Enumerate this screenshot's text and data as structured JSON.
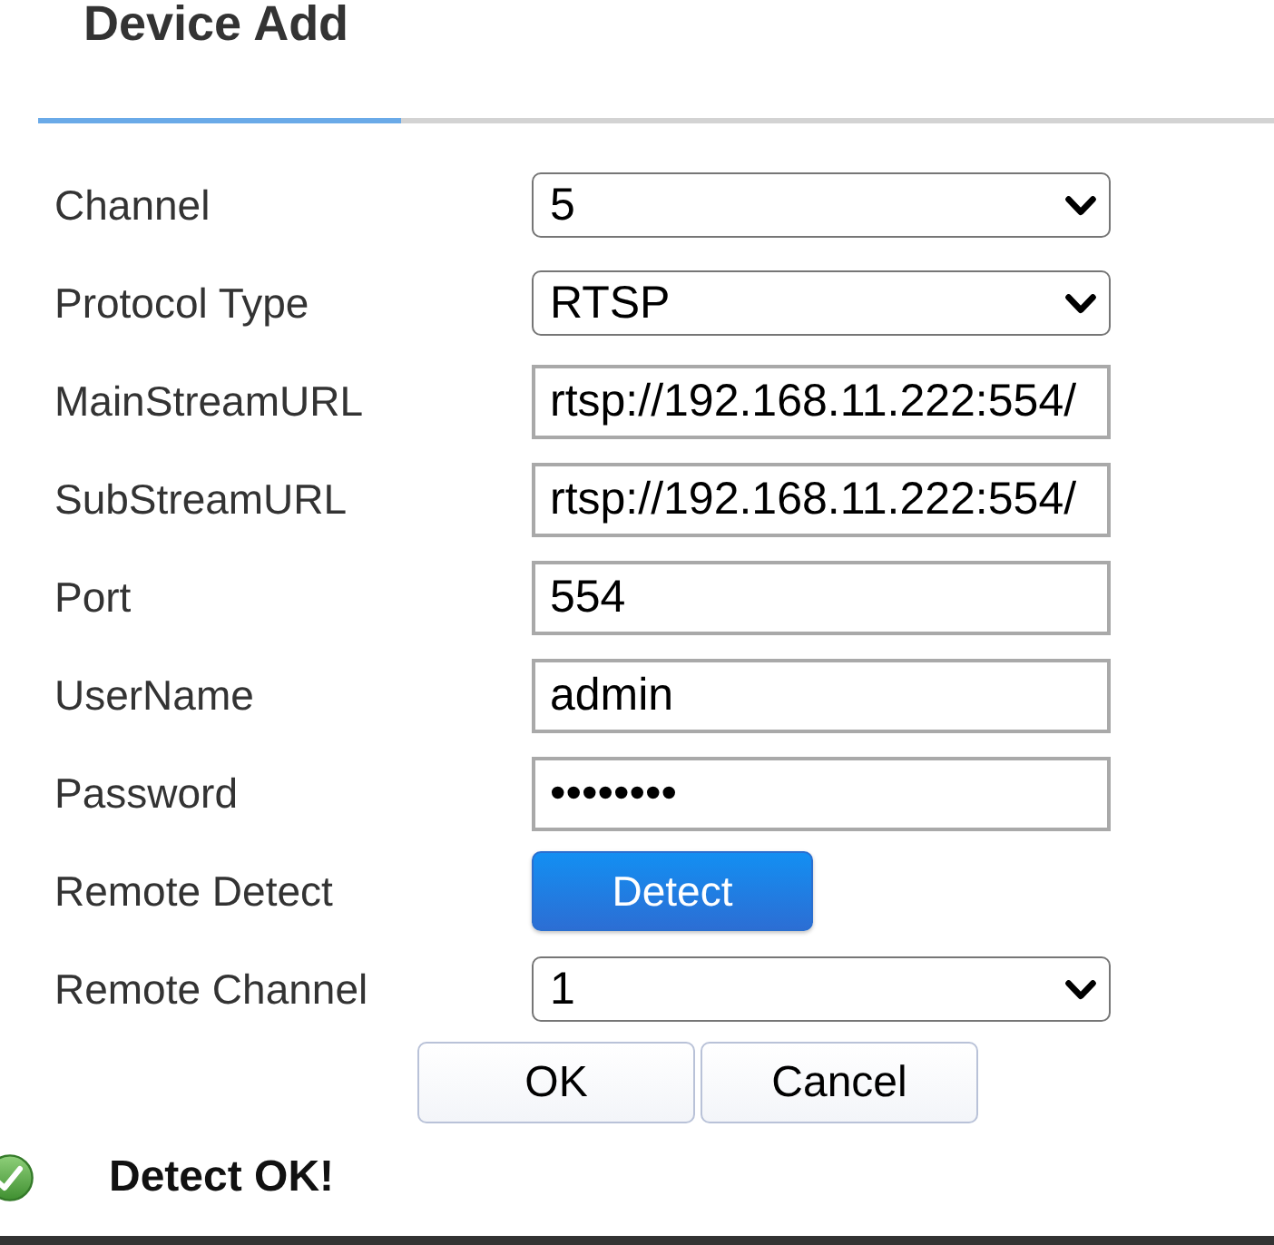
{
  "dialog": {
    "title": "Device Add"
  },
  "fields": [
    {
      "kind": "select",
      "label": "Channel",
      "value": "5"
    },
    {
      "kind": "select",
      "label": "Protocol Type",
      "value": "RTSP"
    },
    {
      "kind": "text",
      "label": "MainStreamURL",
      "value": "rtsp://192.168.11.222:554/"
    },
    {
      "kind": "text",
      "label": "SubStreamURL",
      "value": "rtsp://192.168.11.222:554/"
    },
    {
      "kind": "text",
      "label": "Port",
      "value": "554"
    },
    {
      "kind": "text",
      "label": "UserName",
      "value": "admin"
    },
    {
      "kind": "password",
      "label": "Password",
      "value": "••••••••"
    },
    {
      "kind": "button",
      "label": "Remote Detect",
      "value": "Detect"
    },
    {
      "kind": "select",
      "label": "Remote Channel",
      "value": "1"
    }
  ],
  "buttons": [
    "OK",
    "Cancel"
  ],
  "status": {
    "kind": "success",
    "text": "Detect OK!"
  }
}
